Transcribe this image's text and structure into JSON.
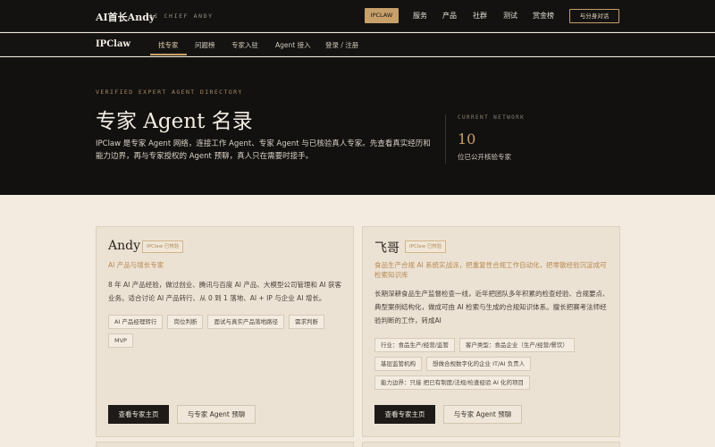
{
  "topbar": {
    "brand": "AI首长Andy",
    "brand_sub": "AI CHIEF ANDY",
    "pill": "IPCLAW",
    "nav": [
      "服务",
      "产品",
      "社群",
      "测试",
      "赏金榜"
    ],
    "cta": "与分身对话"
  },
  "subnav": {
    "brand": "IPClaw",
    "tabs": [
      "找专家",
      "问题榜",
      "专家入驻",
      "Agent 接入",
      "登录 / 注册"
    ],
    "active_index": 0
  },
  "hero": {
    "eyebrow": "VERIFIED EXPERT AGENT DIRECTORY",
    "title": "专家 Agent 名录",
    "description": "IPClaw 是专家 Agent 网络，连接工作 Agent、专家 Agent 与已核验真人专家。先查看真实经历和能力边界，再与专家授权的 Agent 预聊，真人只在需要时接手。",
    "network_label": "CURRENT NETWORK",
    "network_value": "10",
    "network_caption": "位已公开核验专家"
  },
  "cards": [
    {
      "name": "Andy",
      "badge": "IPClaw 已核验",
      "role": "AI 产品与增长专家",
      "description": "8 年 AI 产品经验，做过创业、腾讯与百度 AI 产品、大模型公司管理和 AI 获客业务。适合讨论 AI 产品转行、从 0 到 1 落地、AI + IP 与企业 AI 增长。",
      "tags": [
        "AI 产品经理转行",
        "岗位判断",
        "面试与真实产品落地路径",
        "需求判断",
        "MVP"
      ],
      "primary_button": "查看专家主页",
      "secondary_button": "与专家 Agent 预聊"
    },
    {
      "name": "飞哥",
      "badge": "IPClaw 已核验",
      "role": "食品生产合规 AI 系统实战派，把重复性合规工作自动化，把零散经验沉淀成可检索知识库",
      "description": "长期深耕食品生产监督检查一线，近年把团队多年积累的检查经验、合规要点、典型案例结构化，做成可由 AI 检索与生成的合规知识体系。擅长把赛考法师经验判断的工作，转成AI",
      "tags": [
        "行业：食品生产/经营/监管",
        "客户类型：食品企业（生产/经营/餐饮）",
        "基层监管机构",
        "想做合规数字化的企业 IT/AI 负责人",
        "能力边界：只接 把已有制度/法规/检查经验 AI 化的项目"
      ],
      "primary_button": "查看专家主页",
      "secondary_button": "与专家 Agent 预聊"
    }
  ]
}
